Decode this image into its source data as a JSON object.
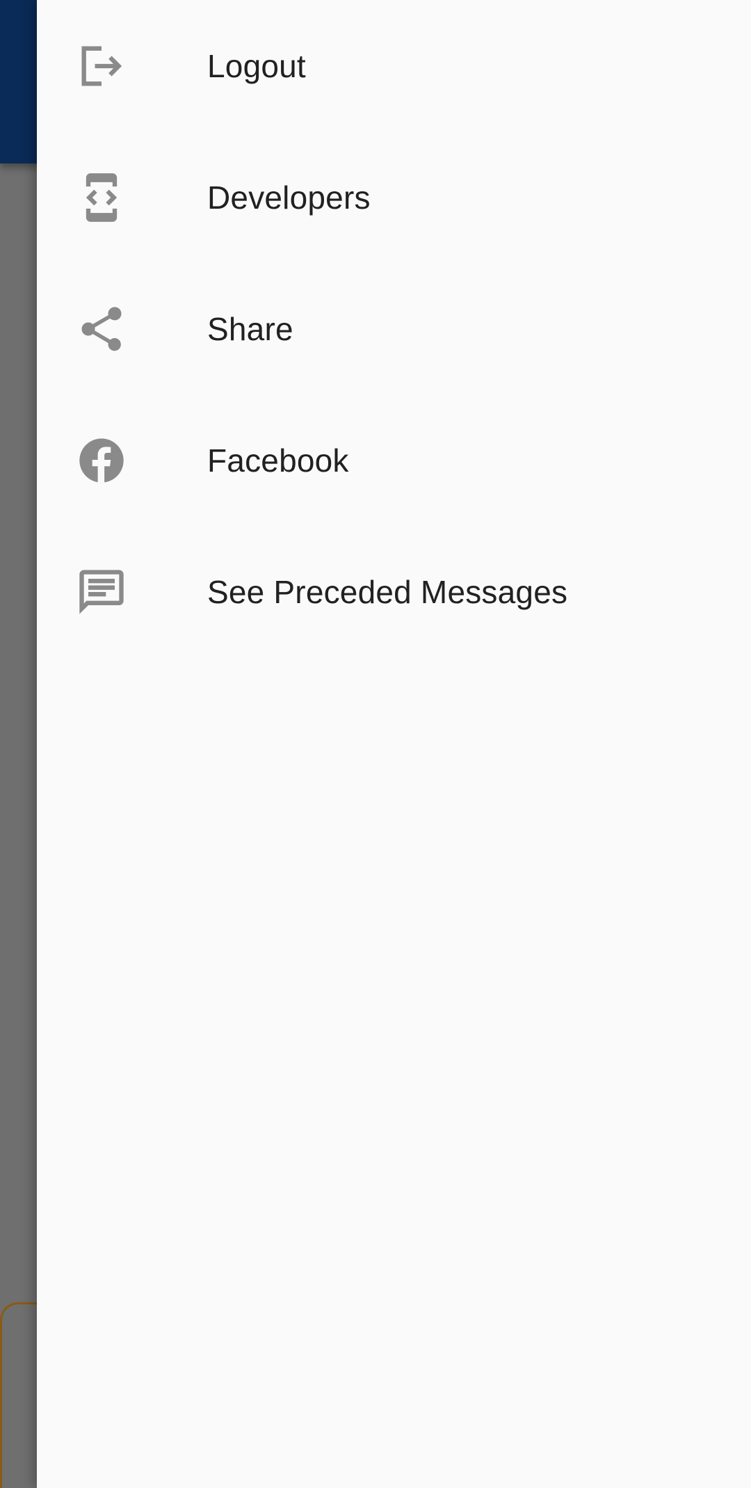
{
  "theme": {
    "scrim_color": "#6f6f6f",
    "appbar_color": "#0a2a57",
    "drawer_color": "#fafafa",
    "icon_color": "#8a8a8a",
    "text_color": "#212121",
    "card_border_color": "#8a5a14"
  },
  "drawer": {
    "items": [
      {
        "label": "Logout",
        "icon": "logout-icon"
      },
      {
        "label": "Developers",
        "icon": "developer-mode-icon"
      },
      {
        "label": "Share",
        "icon": "share-icon"
      },
      {
        "label": "Facebook",
        "icon": "facebook-icon"
      },
      {
        "label": "See Preceded Messages",
        "icon": "chat-message-icon"
      }
    ]
  }
}
